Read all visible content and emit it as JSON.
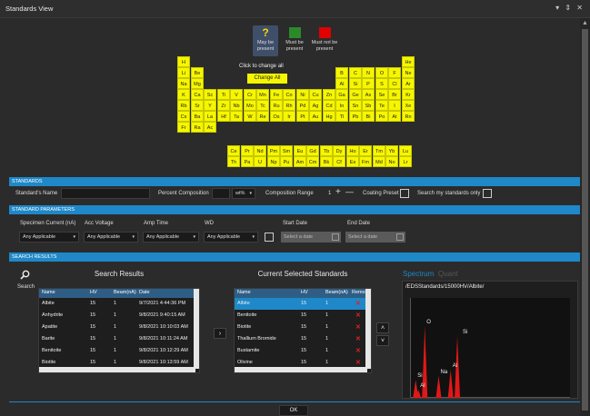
{
  "window": {
    "title": "Standards View",
    "controls": "▾ ⇕ ✕"
  },
  "legend": [
    {
      "label": "May be present",
      "color": "#f6d800",
      "icon": "question-mark-icon"
    },
    {
      "label": "Must be present",
      "color": "#2a8a2a"
    },
    {
      "label": "Must not be present",
      "color": "#e00000"
    }
  ],
  "periodic_table": {
    "note": "Click to change all",
    "change_all": "Change All",
    "cell_color": "#f6f600",
    "rows": [
      [
        "H",
        "",
        "",
        "",
        "",
        "",
        "",
        "",
        "",
        "",
        "",
        "",
        "",
        "",
        "",
        "",
        "",
        "He"
      ],
      [
        "Li",
        "Be",
        "",
        "",
        "",
        "",
        "",
        "",
        "",
        "",
        "",
        "",
        "B",
        "C",
        "N",
        "O",
        "F",
        "Ne"
      ],
      [
        "Na",
        "Mg",
        "",
        "",
        "",
        "",
        "",
        "",
        "",
        "",
        "",
        "",
        "Al",
        "Si",
        "P",
        "S",
        "Cl",
        "Ar"
      ],
      [
        "K",
        "Ca",
        "Sc",
        "Ti",
        "V",
        "Cr",
        "Mn",
        "Fe",
        "Co",
        "Ni",
        "Cu",
        "Zn",
        "Ga",
        "Ge",
        "As",
        "Se",
        "Br",
        "Kr"
      ],
      [
        "Rb",
        "Sr",
        "Y",
        "Zr",
        "Nb",
        "Mo",
        "Tc",
        "Ru",
        "Rh",
        "Pd",
        "Ag",
        "Cd",
        "In",
        "Sn",
        "Sb",
        "Te",
        "I",
        "Xe"
      ],
      [
        "Cs",
        "Ba",
        "La",
        "Hf",
        "Ta",
        "W",
        "Re",
        "Os",
        "Ir",
        "Pt",
        "Au",
        "Hg",
        "Tl",
        "Pb",
        "Bi",
        "Po",
        "At",
        "Rn"
      ],
      [
        "Fr",
        "Ra",
        "Ac",
        "",
        "",
        "",
        "",
        "",
        "",
        "",
        "",
        "",
        "",
        "",
        "",
        "",
        "",
        ""
      ]
    ],
    "lanthanides": [
      "Ce",
      "Pr",
      "Nd",
      "Pm",
      "Sm",
      "Eu",
      "Gd",
      "Tb",
      "Dy",
      "Ho",
      "Er",
      "Tm",
      "Yb",
      "Lu"
    ],
    "actinides": [
      "Th",
      "Pa",
      "U",
      "Np",
      "Pu",
      "Am",
      "Cm",
      "Bk",
      "Cf",
      "Es",
      "Fm",
      "Md",
      "No",
      "Lr"
    ]
  },
  "standards": {
    "header": "STANDARDS",
    "name_label": "Standard's Name",
    "name_value": "",
    "percent_label": "Percent Composition",
    "percent_value": "",
    "unit": "wt%",
    "range_label": "Composition Range",
    "range_value": "1",
    "plus": "+",
    "minus": "—",
    "coating_label": "Coating Preset",
    "search_mine_label": "Search my standards only"
  },
  "parameters": {
    "header": "STANDARD PARAMETERS",
    "specimen_current": {
      "label": "Specimen Current (nA)",
      "value": "Any Applicable"
    },
    "acc_voltage": {
      "label": "Acc Voltage",
      "value": "Any Applicable"
    },
    "amp_time": {
      "label": "Amp Time",
      "value": "Any Applicable"
    },
    "wd": {
      "label": "WD",
      "value": "Any Applicable"
    },
    "start_date": {
      "label": "Start Date",
      "placeholder": "Select a date"
    },
    "end_date": {
      "label": "End Date",
      "placeholder": "Select a date"
    }
  },
  "search_results": {
    "header": "SEARCH RESULTS",
    "search_label": "Search",
    "title": "Search Results",
    "columns": [
      "Name",
      "HV",
      "Beam(nA)",
      "Date"
    ],
    "rows": [
      [
        "Albite",
        "15",
        "1",
        "9/7/2021 4:44:36 PM"
      ],
      [
        "Anhydrite",
        "15",
        "1",
        "9/8/2021 9:40:15 AM"
      ],
      [
        "Apatite",
        "15",
        "1",
        "9/8/2021 10:10:03 AM"
      ],
      [
        "Barite",
        "15",
        "1",
        "9/8/2021 10:11:24 AM"
      ],
      [
        "Benitoite",
        "15",
        "1",
        "9/8/2021 10:12:29 AM"
      ],
      [
        "Biotite",
        "15",
        "1",
        "9/8/2021 10:13:59 AM"
      ]
    ]
  },
  "current": {
    "title": "Current Selected Standards",
    "columns": [
      "Name",
      "HV",
      "Beam(nA)",
      "Remo"
    ],
    "rows": [
      [
        "Albite",
        "15",
        "1"
      ],
      [
        "Benitoite",
        "15",
        "1"
      ],
      [
        "Biotite",
        "15",
        "1"
      ],
      [
        "Thallium Bromide",
        "15",
        "1"
      ],
      [
        "Bustamite",
        "15",
        "1"
      ],
      [
        "Olivine",
        "15",
        "1"
      ]
    ]
  },
  "spectrum": {
    "tab_active": "Spectrum",
    "tab_inactive": "Quant",
    "path": "/EDSStandards/15000HV/Albite/",
    "peaks": [
      {
        "label": "O",
        "energy": 0.52,
        "height": 0.72
      },
      {
        "label": "Si",
        "energy": 1.74,
        "height": 0.62
      },
      {
        "label": "Na",
        "energy": 1.04,
        "height": 0.22
      },
      {
        "label": "Al",
        "energy": 1.49,
        "height": 0.28
      },
      {
        "label": "Si",
        "energy": 0.18,
        "height": 0.18
      },
      {
        "label": "Al",
        "energy": 0.28,
        "height": 0.08
      }
    ]
  },
  "ok_label": "OK"
}
